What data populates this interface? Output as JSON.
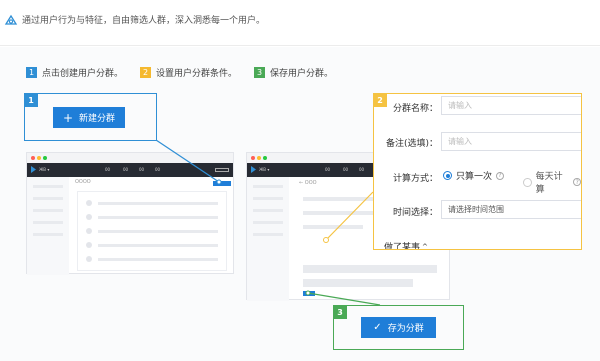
{
  "header": {
    "description": "通过用户行为与特征，自由筛选人群，深入洞悉每一个用户。"
  },
  "steps": [
    {
      "number": "1",
      "label": "点击创建用户分群。",
      "color": "#2f8fd5"
    },
    {
      "number": "2",
      "label": "设置用户分群条件。",
      "color": "#f5b92f"
    },
    {
      "number": "3",
      "label": "保存用户分群。",
      "color": "#4aa956"
    }
  ],
  "callout1": {
    "number": "1",
    "button_label": "新建分群"
  },
  "callout2": {
    "number": "2",
    "name_label": "分群名称：",
    "name_placeholder": "请输入",
    "note_label": "备注(选填)：",
    "note_placeholder": "请输入",
    "method_label": "计算方式：",
    "method_option_once": "只算一次",
    "method_option_daily": "每天计算",
    "time_label": "时间选择：",
    "time_placeholder": "请选择时间范围",
    "partial_text": "做了某事"
  },
  "callout3": {
    "number": "3",
    "button_label": "存为分群"
  },
  "mock_left": {
    "tabs": [
      "00",
      "00",
      "00",
      "00"
    ],
    "toolbar": "OOOO"
  },
  "mock_right": {
    "back_label": "← OOO"
  },
  "colors": {
    "blue": "#1f7ed8",
    "yellow": "#f5c342",
    "green": "#4aa956",
    "nav": "#272b33"
  },
  "icons": {
    "header_icon": "user-group-icon",
    "plus": "plus-icon",
    "check": "check-icon",
    "help": "question-circle-icon",
    "chevron": "chevron-up-icon"
  }
}
